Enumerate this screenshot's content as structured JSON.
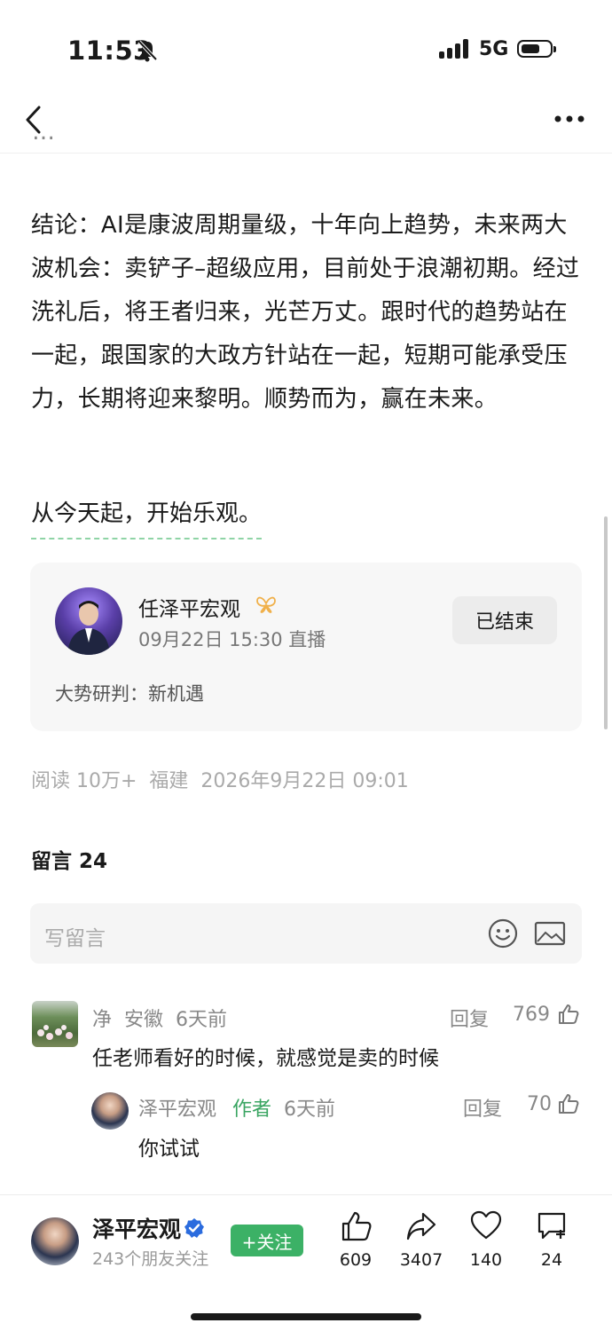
{
  "status_bar": {
    "time": "11:53",
    "network": "5G"
  },
  "article": {
    "conclusion": "结论：AI是康波周期量级，十年向上趋势，未来两大波机会：卖铲子–超级应用，目前处于浪潮初期。经过洗礼后，将王者归来，光芒万丈。跟时代的趋势站在一起，跟国家的大政方针站在一起，短期可能承受压力，长期将迎来黎明。顺势而为，赢在未来。",
    "closing_line": "从今天起，开始乐观。"
  },
  "live_card": {
    "name": "任泽平宏观",
    "time": "09月22日 15:30 直播",
    "status_button": "已结束",
    "topic": "大势研判：新机遇"
  },
  "meta": {
    "text": "阅读 10万+  福建  2026年9月22日 09:01"
  },
  "comments": {
    "title": "留言 24",
    "placeholder": "写留言",
    "items": [
      {
        "header": "净  安徽  6天前",
        "reply": "回复",
        "likes": "769",
        "text": "任老师看好的时候，就感觉是卖的时候",
        "reply_comment": {
          "name": "泽平宏观",
          "tag": "作者",
          "time": "6天前",
          "reply": "回复",
          "likes": "70",
          "text": "你试试"
        }
      }
    ]
  },
  "bottom_bar": {
    "author": "泽平宏观",
    "followers": "243个朋友关注",
    "follow_button": "+关注",
    "actions": {
      "like": "609",
      "share": "3407",
      "heart": "140",
      "comment": "24"
    }
  },
  "colors": {
    "accent_green": "#3cb166",
    "author_tag": "#3aa562",
    "verified": "#2b6cde",
    "badge": "#f0b04a"
  },
  "icons": [
    "bell-off-icon",
    "signal-icon",
    "battery-icon",
    "back-icon",
    "more-icon",
    "butterfly-badge-icon",
    "emoji-icon",
    "image-icon",
    "thumb-up-icon",
    "verified-icon",
    "share-icon",
    "heart-icon",
    "comment-plus-icon"
  ]
}
